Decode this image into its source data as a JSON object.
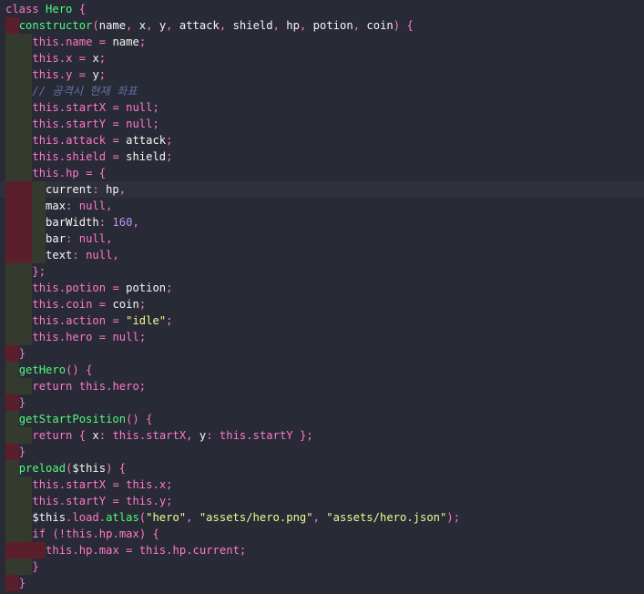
{
  "editor": {
    "colors": {
      "background": "#282a36",
      "keyword": "#ff79c6",
      "function": "#50fa7b",
      "string": "#f1fa8c",
      "number": "#bd93f9",
      "comment": "#6272a4",
      "param": "#ffb86c",
      "indent_guide_ok": "#353a2f",
      "indent_guide_error": "#5a1f2b"
    },
    "lines": [
      {
        "text": "class Hero {",
        "indent": 0,
        "guides": []
      },
      {
        "text": "  constructor(name, x, y, attack, shield, hp, potion, coin) {",
        "indent": 1,
        "guides": [
          "e"
        ]
      },
      {
        "text": "    this.name = name;",
        "indent": 2,
        "guides": [
          "g",
          "o"
        ]
      },
      {
        "text": "    this.x = x;",
        "indent": 2,
        "guides": [
          "g",
          "o"
        ]
      },
      {
        "text": "    this.y = y;",
        "indent": 2,
        "guides": [
          "g",
          "o"
        ]
      },
      {
        "text": "    // 공격시 현재 좌표",
        "indent": 2,
        "guides": [
          "g",
          "o"
        ]
      },
      {
        "text": "    this.startX = null;",
        "indent": 2,
        "guides": [
          "g",
          "o"
        ]
      },
      {
        "text": "    this.startY = null;",
        "indent": 2,
        "guides": [
          "g",
          "o"
        ]
      },
      {
        "text": "    this.attack = attack;",
        "indent": 2,
        "guides": [
          "g",
          "o"
        ]
      },
      {
        "text": "    this.shield = shield;",
        "indent": 2,
        "guides": [
          "g",
          "o"
        ]
      },
      {
        "text": "    this.hp = {",
        "indent": 2,
        "guides": [
          "g",
          "o"
        ]
      },
      {
        "text": "      current: hp,",
        "indent": 3,
        "guides": [
          "e",
          "e",
          "o"
        ],
        "current": true
      },
      {
        "text": "      max: null,",
        "indent": 3,
        "guides": [
          "e",
          "e",
          "o"
        ]
      },
      {
        "text": "      barWidth: 160,",
        "indent": 3,
        "guides": [
          "e",
          "e",
          "o"
        ]
      },
      {
        "text": "      bar: null,",
        "indent": 3,
        "guides": [
          "e",
          "e",
          "o"
        ]
      },
      {
        "text": "      text: null,",
        "indent": 3,
        "guides": [
          "e",
          "e",
          "o"
        ]
      },
      {
        "text": "    };",
        "indent": 2,
        "guides": [
          "g",
          "o"
        ]
      },
      {
        "text": "    this.potion = potion;",
        "indent": 2,
        "guides": [
          "g",
          "o"
        ]
      },
      {
        "text": "    this.coin = coin;",
        "indent": 2,
        "guides": [
          "g",
          "o"
        ]
      },
      {
        "text": "    this.action = \"idle\";",
        "indent": 2,
        "guides": [
          "g",
          "o"
        ]
      },
      {
        "text": "    this.hero = null;",
        "indent": 2,
        "guides": [
          "g",
          "o"
        ]
      },
      {
        "text": "  }",
        "indent": 1,
        "guides": [
          "e"
        ]
      },
      {
        "text": "  getHero() {",
        "indent": 1,
        "guides": [
          "g"
        ]
      },
      {
        "text": "    return this.hero;",
        "indent": 2,
        "guides": [
          "g",
          "o"
        ]
      },
      {
        "text": "  }",
        "indent": 1,
        "guides": [
          "e"
        ]
      },
      {
        "text": "  getStartPosition() {",
        "indent": 1,
        "guides": [
          "g"
        ]
      },
      {
        "text": "    return { x: this.startX, y: this.startY };",
        "indent": 2,
        "guides": [
          "g",
          "o"
        ]
      },
      {
        "text": "  }",
        "indent": 1,
        "guides": [
          "e"
        ]
      },
      {
        "text": "  preload($this) {",
        "indent": 1,
        "guides": [
          "g"
        ]
      },
      {
        "text": "    this.startX = this.x;",
        "indent": 2,
        "guides": [
          "g",
          "o"
        ]
      },
      {
        "text": "    this.startY = this.y;",
        "indent": 2,
        "guides": [
          "g",
          "o"
        ]
      },
      {
        "text": "    $this.load.atlas(\"hero\", \"assets/hero.png\", \"assets/hero.json\");",
        "indent": 2,
        "guides": [
          "g",
          "o"
        ]
      },
      {
        "text": "    if (!this.hp.max) {",
        "indent": 2,
        "guides": [
          "g",
          "o"
        ]
      },
      {
        "text": "      this.hp.max = this.hp.current;",
        "indent": 3,
        "guides": [
          "e",
          "e",
          "e"
        ]
      },
      {
        "text": "    }",
        "indent": 2,
        "guides": [
          "g",
          "o"
        ]
      },
      {
        "text": "  }",
        "indent": 1,
        "guides": [
          "e"
        ]
      }
    ]
  }
}
